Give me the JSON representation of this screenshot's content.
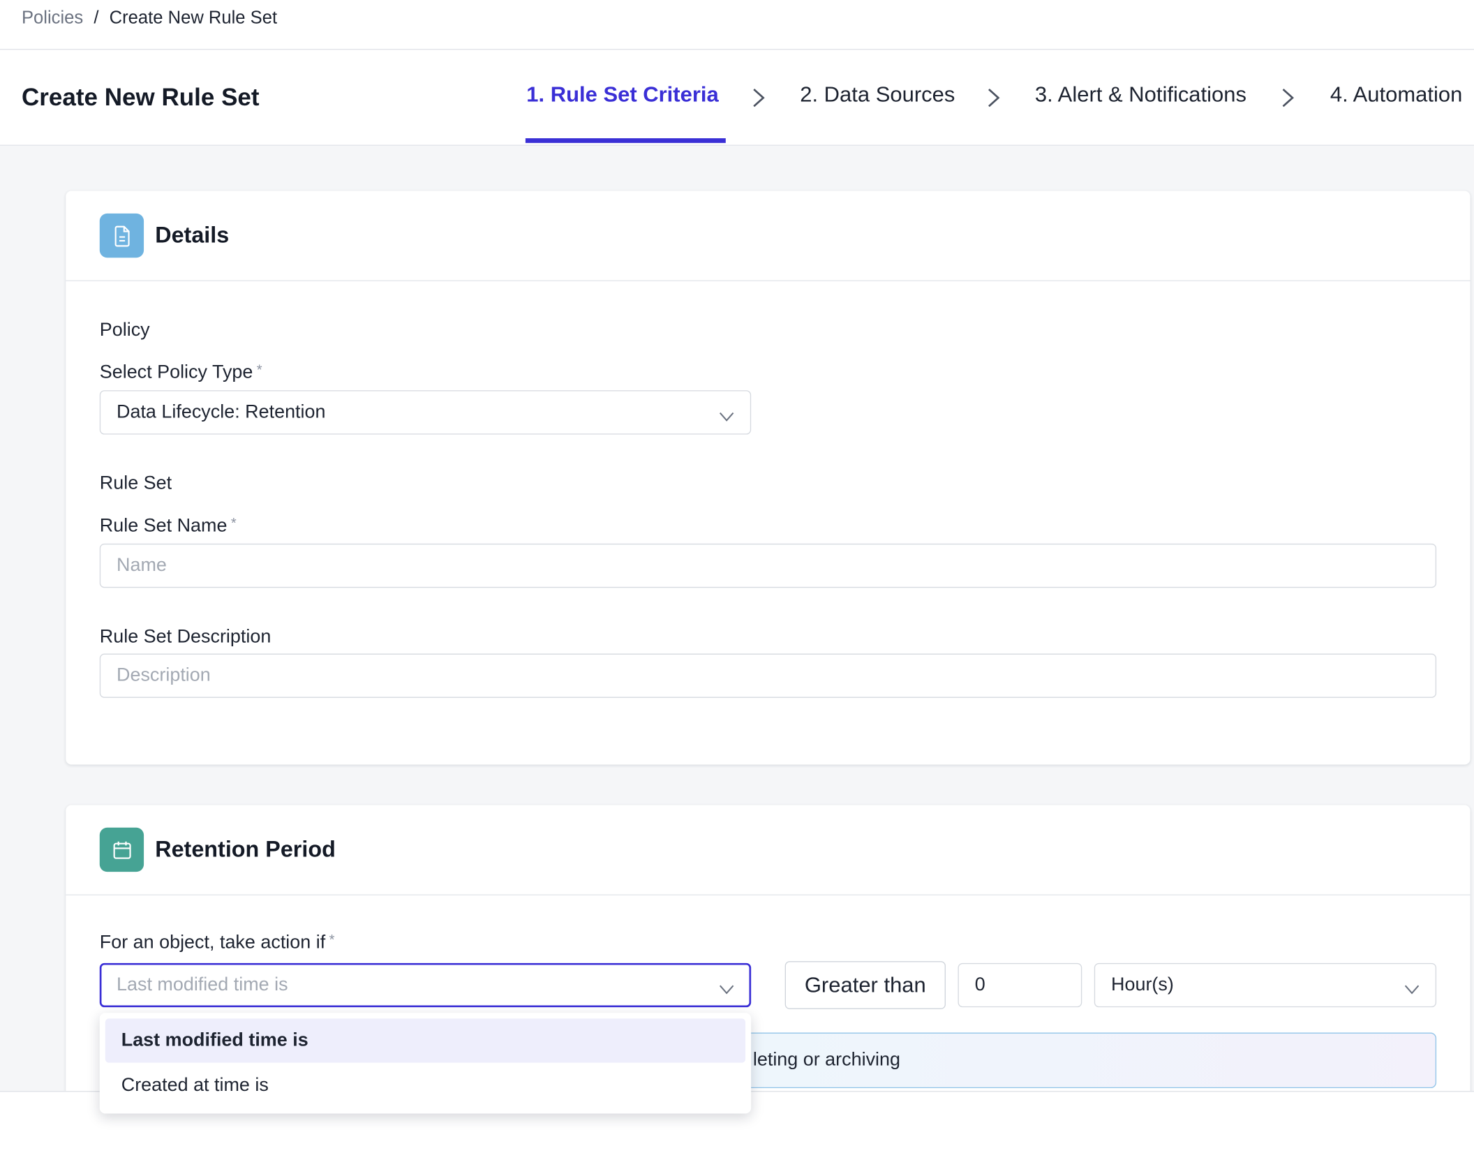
{
  "breadcrumb": {
    "root": "Policies",
    "separator": "/",
    "current": "Create New Rule Set"
  },
  "header": {
    "title": "Create New Rule Set",
    "steps": [
      {
        "label": "1. Rule Set Criteria",
        "active": true
      },
      {
        "label": "2. Data Sources",
        "active": false
      },
      {
        "label": "3. Alert & Notifications",
        "active": false
      },
      {
        "label": "4. Automation",
        "active": false
      }
    ]
  },
  "details": {
    "icon": "document-icon",
    "title": "Details",
    "policy_section": "Policy",
    "policy_type_label": "Select Policy Type",
    "policy_type_value": "Data Lifecycle: Retention",
    "required_mark": "*",
    "rule_set_section": "Rule Set",
    "name_label": "Rule Set Name",
    "name_placeholder": "Name",
    "description_label": "Rule Set Description",
    "description_placeholder": "Description"
  },
  "retention": {
    "icon": "calendar-icon",
    "title": "Retention Period",
    "condition_label": "For an object, take action if",
    "condition_placeholder": "Last modified time is",
    "comparator": "Greater than",
    "amount_value": "0",
    "unit_value": "Hour(s)",
    "info_text": "leting or archiving",
    "options": [
      {
        "label": "Last modified time is",
        "selected": true
      },
      {
        "label": "Created at time is",
        "selected": false
      }
    ]
  },
  "colors": {
    "accent": "#3a2fd6",
    "details_icon_bg": "#6fb3e0",
    "retention_icon_bg": "#46a394"
  }
}
